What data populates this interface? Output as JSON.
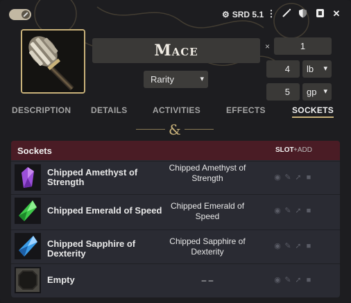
{
  "header": {
    "system_label": "SRD 5.1",
    "icons": [
      "toggle-switch",
      "gear-icon",
      "menu-dots-icon",
      "wand-icon",
      "shield-icon",
      "sheet-icon",
      "close-icon"
    ]
  },
  "item": {
    "name": "Mace",
    "rarity": "Rarity",
    "quantity_sep": "×",
    "quantity": "1",
    "weight": "4",
    "weight_unit": "lb",
    "price": "5",
    "price_unit": "gp"
  },
  "tabs": [
    {
      "label": "DESCRIPTION"
    },
    {
      "label": "DETAILS"
    },
    {
      "label": "ACTIVITIES"
    },
    {
      "label": "EFFECTS"
    },
    {
      "label": "SOCKETS"
    }
  ],
  "divider_glyph": "&",
  "sockets": {
    "title": "Sockets",
    "slot_label": "SLOT",
    "add_label": "+ADD",
    "rows": [
      {
        "name": "Chipped Amethyst of Strength",
        "desc": "Chipped Amethyst of Strength",
        "gem": "amethyst-gem-icon",
        "color": "#9b4fd9"
      },
      {
        "name": "Chipped Emerald of Speed",
        "desc": "Chipped Emerald of Speed",
        "gem": "emerald-gem-icon",
        "color": "#3ec94a"
      },
      {
        "name": "Chipped Sapphire of Dexterity",
        "desc": "Chipped Sapphire of Dexterity",
        "gem": "sapphire-gem-icon",
        "color": "#3a9be6"
      },
      {
        "name": "Empty",
        "desc": "– –",
        "gem": "empty-socket-icon",
        "color": "#3a3936"
      }
    ]
  },
  "colors": {
    "accent": "#c9b27a",
    "panel_header": "#4a1c25",
    "panel_bg": "#2a2b33"
  }
}
